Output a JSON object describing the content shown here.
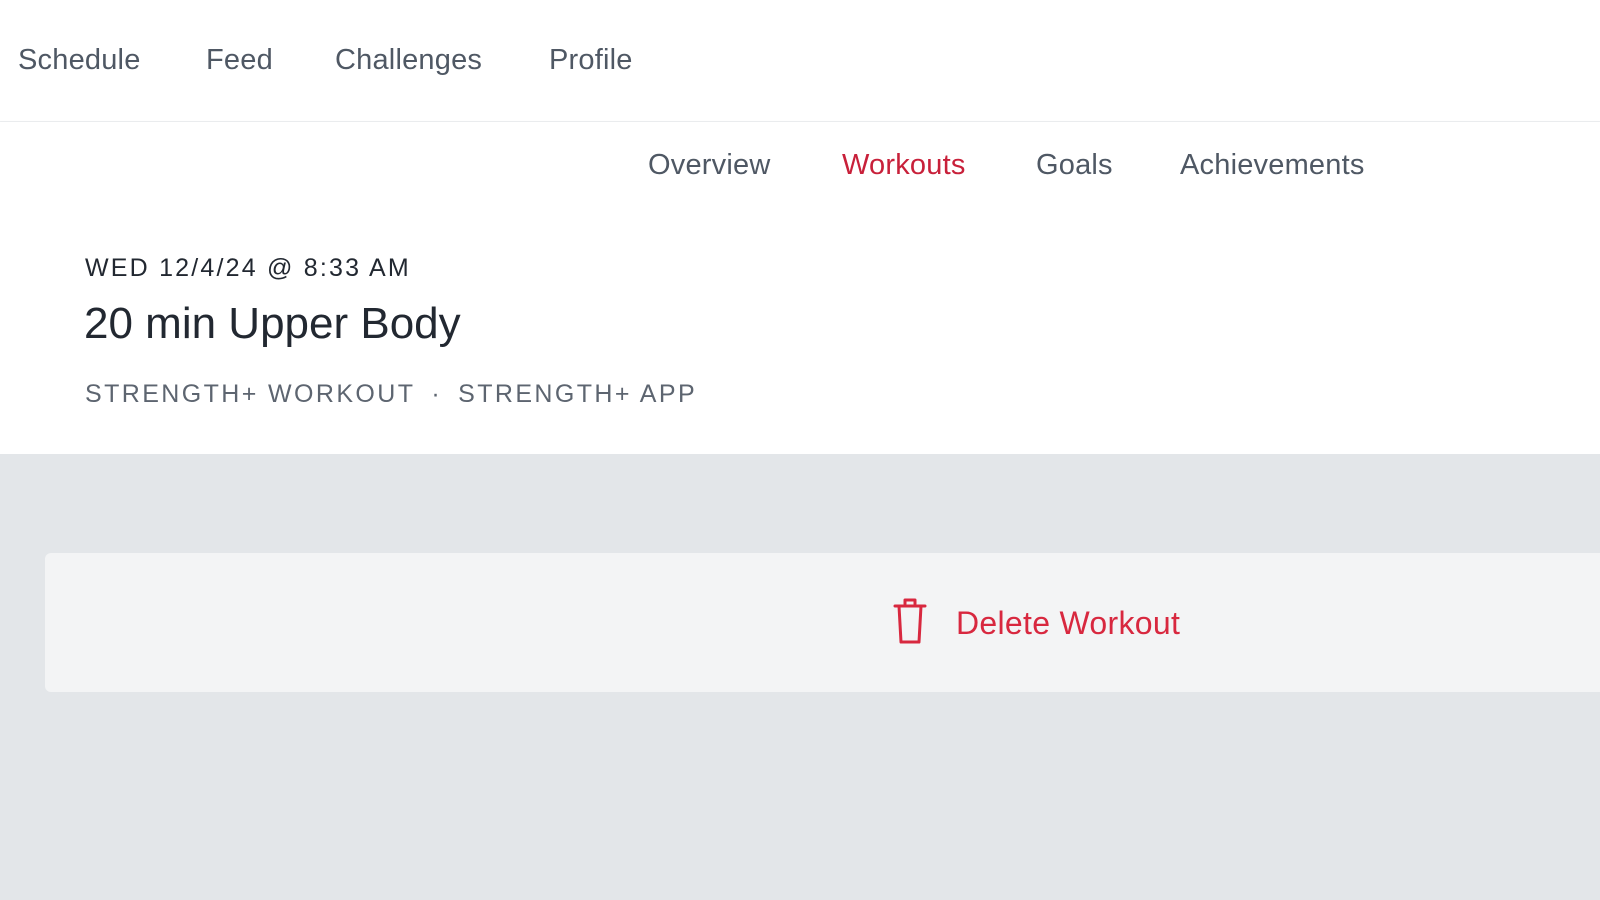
{
  "top_nav": {
    "items": [
      {
        "label": "Schedule"
      },
      {
        "label": "Feed"
      },
      {
        "label": "Challenges"
      },
      {
        "label": "Profile"
      }
    ]
  },
  "sub_nav": {
    "items": [
      {
        "label": "Overview",
        "active": false
      },
      {
        "label": "Workouts",
        "active": true
      },
      {
        "label": "Goals",
        "active": false
      },
      {
        "label": "Achievements",
        "active": false
      }
    ]
  },
  "workout": {
    "date": "WED 12/4/24 @ 8:33 AM",
    "title": "20 min Upper Body",
    "type": "STRENGTH+ WORKOUT",
    "separator": "·",
    "source": "STRENGTH+ APP"
  },
  "actions": {
    "delete_label": "Delete Workout",
    "delete_icon": "trash-icon"
  },
  "colors": {
    "accent": "#c8203a",
    "delete": "#d8283f",
    "nav_text": "#4f5864",
    "page_background": "#e3e6e9"
  }
}
